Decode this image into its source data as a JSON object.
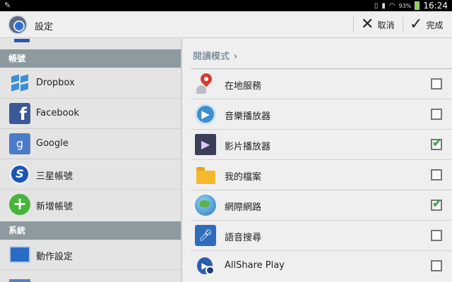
{
  "status_bar": {
    "battery_percent": "93%",
    "battery_level": 0.93,
    "time": "16:24",
    "icons": [
      "pencil-icon",
      "vibrate-icon",
      "signal-icon",
      "wifi-icon",
      "battery-icon"
    ]
  },
  "action_bar": {
    "title": "設定",
    "cancel_label": "取消",
    "done_label": "完成"
  },
  "left_panel": {
    "section_account": "帳號",
    "section_system": "系統",
    "items": [
      {
        "label": "Dropbox",
        "icon": "dropbox-icon"
      },
      {
        "label": "Facebook",
        "icon": "facebook-icon"
      },
      {
        "label": "Google",
        "icon": "google-icon"
      },
      {
        "label": "三星帳號",
        "icon": "samsung-account-icon"
      },
      {
        "label": "新增帳號",
        "icon": "add-account-icon"
      }
    ],
    "system_items": [
      {
        "label": "動作設定",
        "icon": "motion-icon"
      }
    ]
  },
  "right_panel": {
    "mode_link": "閱讀模式",
    "items": [
      {
        "label": "在地服務",
        "icon": "maps-icon",
        "checked": false
      },
      {
        "label": "音樂播放器",
        "icon": "music-player-icon",
        "checked": false
      },
      {
        "label": "影片播放器",
        "icon": "video-player-icon",
        "checked": true
      },
      {
        "label": "我的檔案",
        "icon": "folder-icon",
        "checked": false
      },
      {
        "label": "網際網路",
        "icon": "globe-icon",
        "checked": true
      },
      {
        "label": "語音搜尋",
        "icon": "voice-search-icon",
        "checked": false
      },
      {
        "label": "AllShare Play",
        "icon": "allshare-icon",
        "checked": false
      }
    ]
  },
  "colors": {
    "section_header": "#8d9aa0",
    "check_green": "#3aa845"
  }
}
